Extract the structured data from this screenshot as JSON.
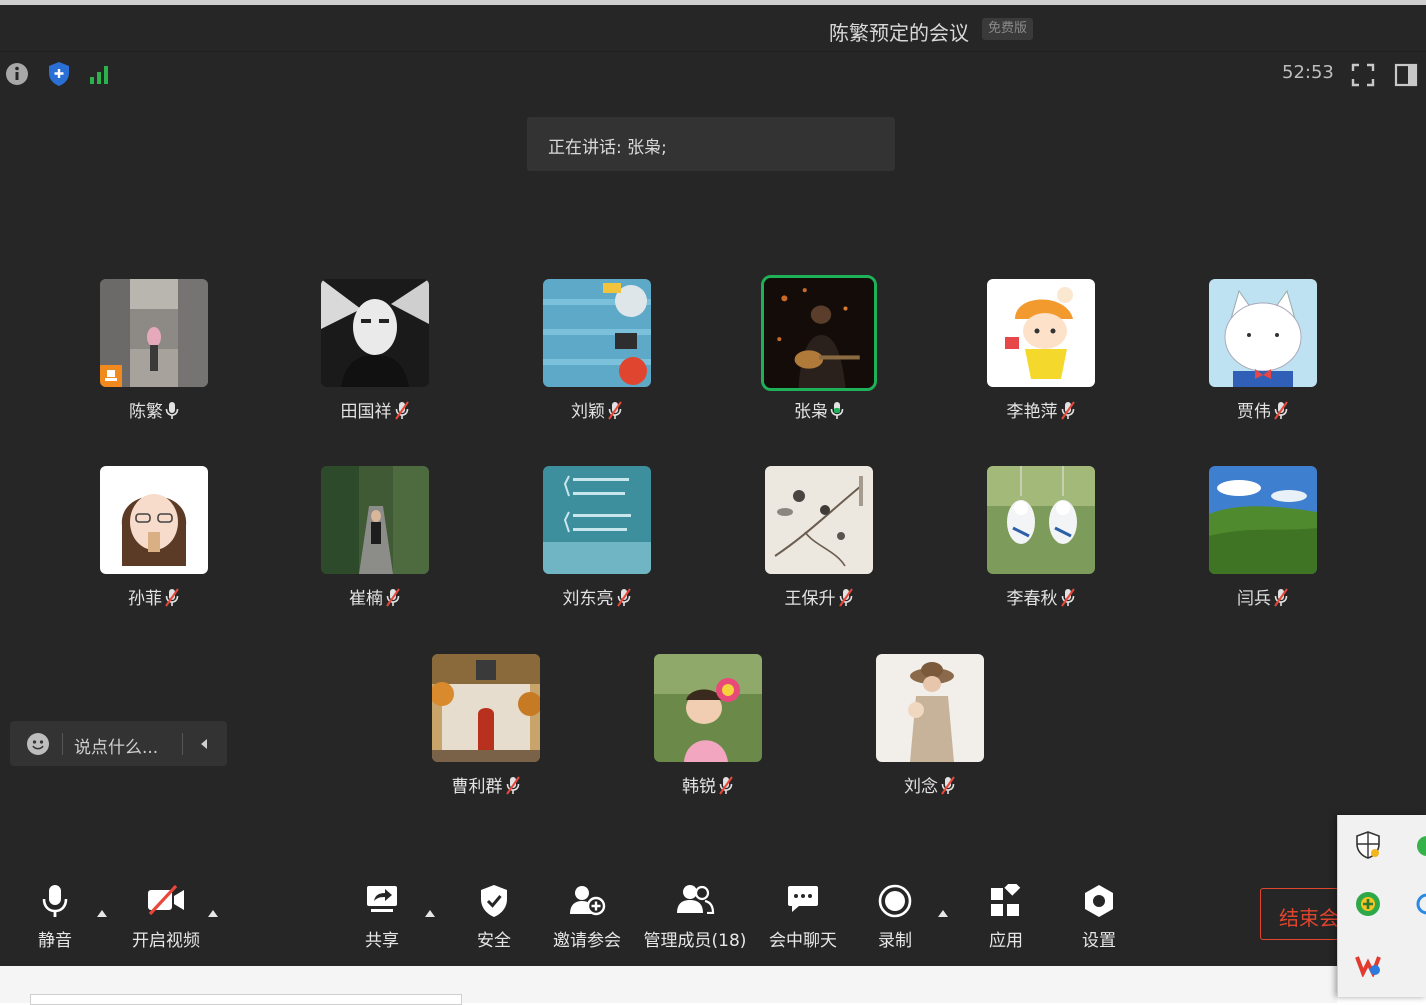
{
  "window": {
    "title": "陈繁预定的会议",
    "badge": "免费版"
  },
  "timer": "52:53",
  "speaking": "正在讲话: 张枭;",
  "participants": [
    {
      "name": "陈繁",
      "mic": "on",
      "host": true
    },
    {
      "name": "田国祥",
      "mic": "muted"
    },
    {
      "name": "刘颖",
      "mic": "muted"
    },
    {
      "name": "张枭",
      "mic": "on",
      "speaking": true
    },
    {
      "name": "李艳萍",
      "mic": "muted"
    },
    {
      "name": "贾伟",
      "mic": "muted"
    },
    {
      "name": "孙菲",
      "mic": "muted"
    },
    {
      "name": "崔楠",
      "mic": "muted"
    },
    {
      "name": "刘东亮",
      "mic": "muted"
    },
    {
      "name": "王保升",
      "mic": "muted"
    },
    {
      "name": "李春秋",
      "mic": "muted"
    },
    {
      "name": "闫兵",
      "mic": "muted"
    },
    {
      "name": "曹利群",
      "mic": "muted"
    },
    {
      "name": "韩锐",
      "mic": "muted"
    },
    {
      "name": "刘念",
      "mic": "muted"
    }
  ],
  "chat": {
    "placeholder": "说点什么..."
  },
  "toolbar": {
    "mute": "静音",
    "video": "开启视频",
    "share": "共享",
    "security": "安全",
    "invite": "邀请参会",
    "members": "管理成员(18)",
    "chat": "会中聊天",
    "record": "录制",
    "apps": "应用",
    "settings": "设置",
    "end": "结束会"
  },
  "colors": {
    "background": "#262626",
    "speaking_border": "#1fb05a",
    "end": "#e0452d",
    "signal": "#2bb24c",
    "shield": "#2a6fd6"
  }
}
